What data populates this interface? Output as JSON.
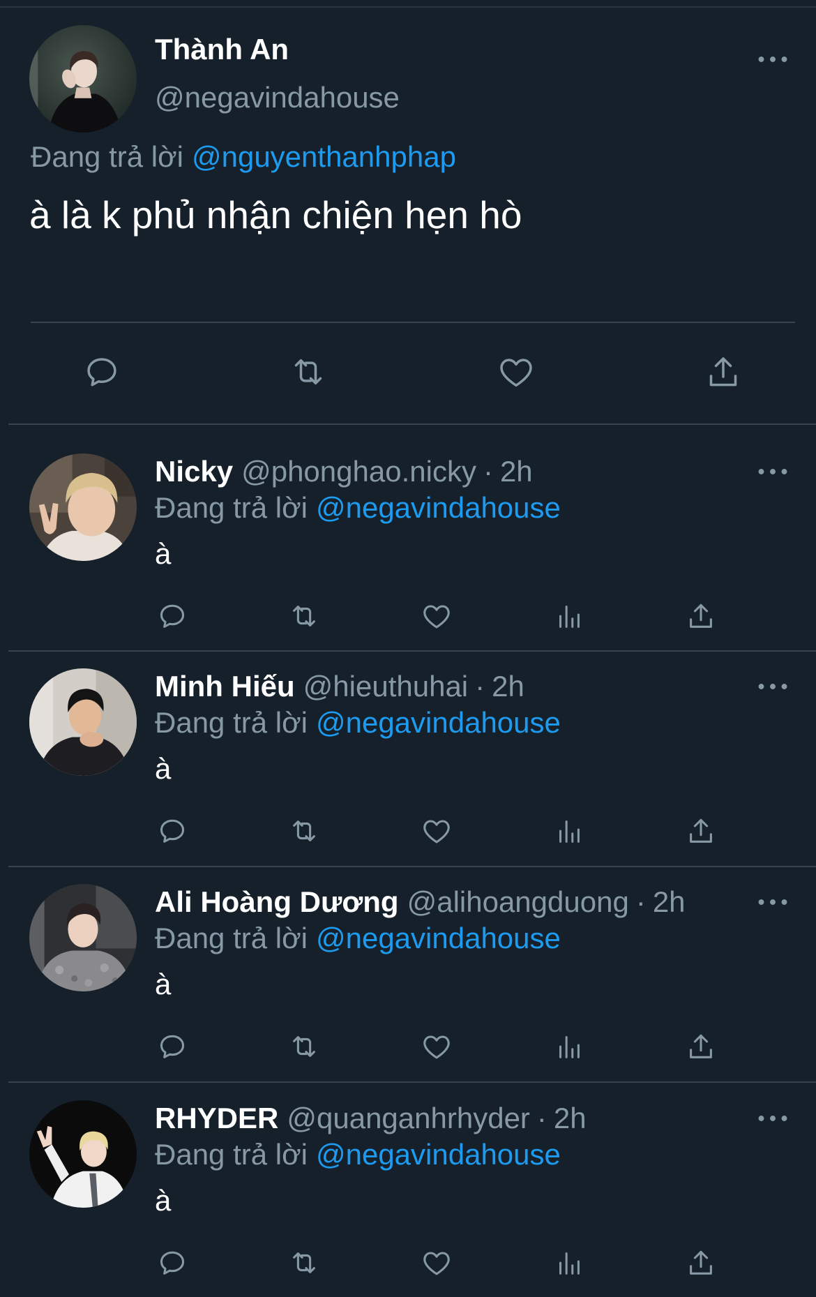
{
  "colors": {
    "background": "#15202b",
    "text": "#ffffff",
    "muted": "#8899a6",
    "accent": "#1d9bf0",
    "divider": "#38444d"
  },
  "main_tweet": {
    "author": {
      "name": "Thành An",
      "handle": "@negavindahouse"
    },
    "reply_prefix": "Đang trả lời",
    "reply_to": "@nguyenthanhphap",
    "text": "à là k phủ nhận chiện hẹn hò",
    "menu_icon": "more-icon",
    "actions": [
      "reply-icon",
      "retweet-icon",
      "like-icon",
      "share-icon"
    ]
  },
  "replies": [
    {
      "name": "Nicky",
      "handle": "@phonghao.nicky",
      "separator": "·",
      "time": "2h",
      "reply_prefix": "Đang trả lời",
      "reply_to": "@negavindahouse",
      "text": "à"
    },
    {
      "name": "Minh Hiếu",
      "handle": "@hieuthuhai",
      "separator": "·",
      "time": "2h",
      "reply_prefix": "Đang trả lời",
      "reply_to": "@negavindahouse",
      "text": "à"
    },
    {
      "name": "Ali Hoàng Dương",
      "handle": "@alihoangduong",
      "separator": "·",
      "time": "2h",
      "reply_prefix": "Đang trả lời",
      "reply_to": "@negavindahouse",
      "text": "à"
    },
    {
      "name": "RHYDER",
      "handle": "@quanganhrhyder",
      "separator": "·",
      "time": "2h",
      "reply_prefix": "Đang trả lời",
      "reply_to": "@negavindahouse",
      "text": "à"
    }
  ],
  "reply_actions": [
    "reply-icon",
    "retweet-icon",
    "like-icon",
    "analytics-icon",
    "share-icon"
  ]
}
